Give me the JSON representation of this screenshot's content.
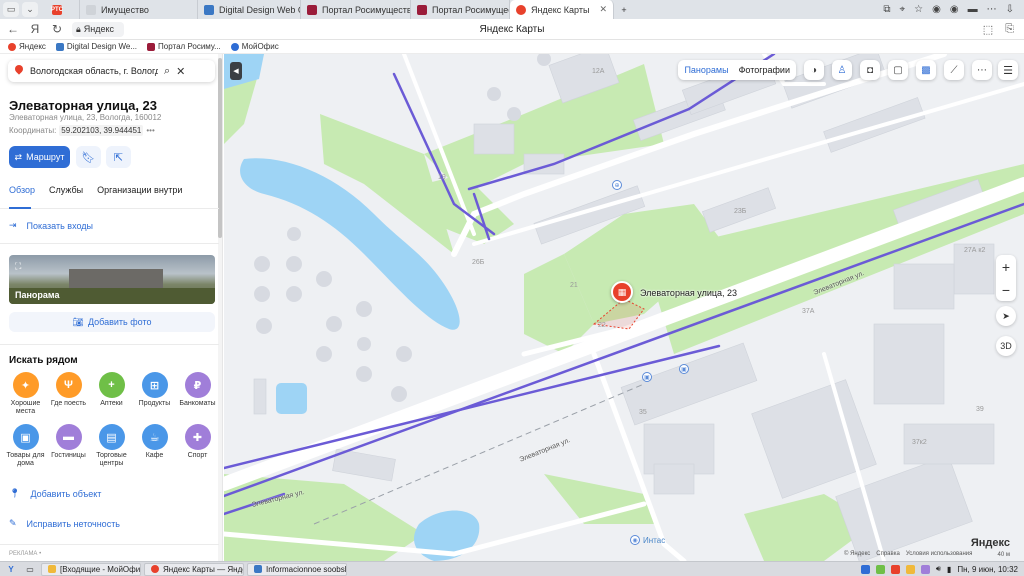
{
  "browser": {
    "tabs": [
      {
        "label": "",
        "favicon_color": "#e8412c",
        "favicon_text": "РТС"
      },
      {
        "label": "Имущество",
        "favicon_color": "#cfd3d8"
      },
      {
        "label": "Digital Design Web Client",
        "favicon_color": "#3b78c4"
      },
      {
        "label": "Портал Росимущества",
        "favicon_color": "#9b1c3a"
      },
      {
        "label": "Портал Росимущества",
        "favicon_color": "#9b1c3a"
      },
      {
        "label": "Яндекс Карты",
        "favicon_color": "#e8412c",
        "active": true
      }
    ],
    "address": "Яндекс",
    "page_title": "Яндекс Карты",
    "bookmarks": [
      {
        "label": "Яндекс",
        "color": "#e8412c"
      },
      {
        "label": "Digital Design We...",
        "color": "#3b78c4"
      },
      {
        "label": "Портал Росиму...",
        "color": "#9b1c3a"
      },
      {
        "label": "МойОфис",
        "color": "#2f6dd5"
      }
    ]
  },
  "sidebar": {
    "search_value": "Вологодская область, г. Вологда, ул.",
    "title": "Элеваторная улица, 23",
    "address": "Элеваторная улица, 23, Вологда, 160012",
    "coords_label": "Координаты:",
    "coords_value": "59.202103, 39.944451",
    "coords_more": "•••",
    "route_label": "Маршрут",
    "tabs": [
      "Обзор",
      "Службы",
      "Организации внутри"
    ],
    "entrances_label": "Показать входы",
    "panorama_label": "Панорама",
    "add_photo_label": "Добавить фото",
    "nearby_title": "Искать рядом",
    "categories": [
      {
        "label": "Хорошие места",
        "color": "#ff9b28",
        "glyph": "✦"
      },
      {
        "label": "Где поесть",
        "color": "#ff9b28",
        "glyph": "Ψ"
      },
      {
        "label": "Аптеки",
        "color": "#6fbf47",
        "glyph": "+"
      },
      {
        "label": "Продукты",
        "color": "#4a97e8",
        "glyph": "⊞"
      },
      {
        "label": "Банкоматы",
        "color": "#a07ed9",
        "glyph": "₽"
      },
      {
        "label": "Товары для дома",
        "color": "#4a97e8",
        "glyph": "▣"
      },
      {
        "label": "Гостиницы",
        "color": "#a07ed9",
        "glyph": "▬"
      },
      {
        "label": "Торговые центры",
        "color": "#4a97e8",
        "glyph": "▤"
      },
      {
        "label": "Кафе",
        "color": "#4a97e8",
        "glyph": "☕"
      },
      {
        "label": "Спорт",
        "color": "#a07ed9",
        "glyph": "✚"
      }
    ],
    "add_object_label": "Добавить объект",
    "fix_error_label": "Исправить неточность",
    "ad_label": "РЕКЛАМА •"
  },
  "map": {
    "tools": {
      "panoramas": "Панорамы",
      "photos": "Фотографии"
    },
    "marker_label": "Элеваторная улица, 23",
    "streets": {
      "main": "Элеваторная ул.",
      "lower": "Элеваторная ул."
    },
    "house_numbers": [
      "12А",
      "19",
      "26Б",
      "21",
      "22",
      "23Б",
      "27А к2",
      "37А",
      "35",
      "37к2",
      "39"
    ],
    "poi_intas": "Интас",
    "copyright": [
      "© Яндекс",
      "Справка",
      "Условия использования"
    ],
    "logo": "Яндекс",
    "scale": "40 м",
    "zoom_in": "+",
    "zoom_out": "−",
    "view_3d": "3D"
  },
  "taskbar": {
    "items": [
      {
        "label": "[Входящие - МойОфис П...",
        "color": "#f0b93b"
      },
      {
        "label": "Яндекс Карты — Яндекс ...",
        "color": "#e8412c"
      },
      {
        "label": "Informacionnoe soobshhe...",
        "color": "#3b78c4"
      }
    ],
    "clock": "Пн, 9 июн, 10:32"
  },
  "colors": {
    "accent": "#2f6dd5",
    "marker": "#e8412c",
    "park": "#c7eab2",
    "water": "#9ed4f5",
    "road_main": "#6b5bd6"
  }
}
